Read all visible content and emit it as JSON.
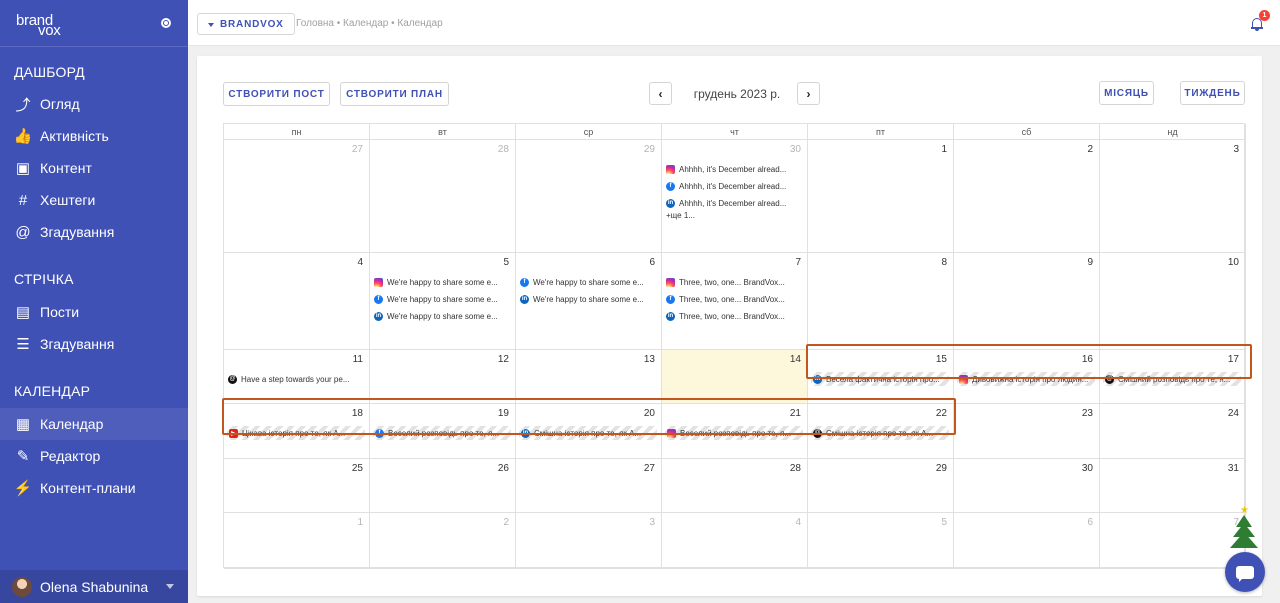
{
  "sidebar": {
    "logo": {
      "top": "brand",
      "bottom": "vox"
    },
    "sections": [
      {
        "title": "ДАШБОРД",
        "items": [
          {
            "label": "Огляд",
            "icon": "chart-icon"
          },
          {
            "label": "Активність",
            "icon": "thumb-up-icon"
          },
          {
            "label": "Контент",
            "icon": "content-icon"
          },
          {
            "label": "Хештеги",
            "icon": "hashtag-icon"
          },
          {
            "label": "Згадування",
            "icon": "at-icon"
          }
        ]
      },
      {
        "title": "СТРІЧКА",
        "items": [
          {
            "label": "Пости",
            "icon": "document-icon"
          },
          {
            "label": "Згадування",
            "icon": "list-icon"
          }
        ]
      },
      {
        "title": "КАЛЕНДАР",
        "items": [
          {
            "label": "Календар",
            "icon": "calendar-icon"
          },
          {
            "label": "Редактор",
            "icon": "editor-icon"
          },
          {
            "label": "Контент-плани",
            "icon": "bolt-icon"
          }
        ]
      }
    ],
    "user": {
      "name": "Olena Shabunina"
    }
  },
  "topbar": {
    "brand_label": "BRANDVOX",
    "breadcrumb": "Головна • Календар • Календар",
    "notifications": "1"
  },
  "toolbar": {
    "create_post": "СТВОРИТИ ПОСТ",
    "create_plan": "СТВОРИТИ ПЛАН",
    "prev": "‹",
    "next": "›",
    "month": "грудень 2023 р.",
    "view_month": "МІСЯЦЬ",
    "view_week": "ТИЖДЕНЬ"
  },
  "calendar": {
    "weekdays": [
      "пн",
      "вт",
      "ср",
      "чт",
      "пт",
      "сб",
      "нд"
    ],
    "weeks": [
      [
        {
          "d": "27",
          "muted": true
        },
        {
          "d": "28",
          "muted": true
        },
        {
          "d": "29",
          "muted": true
        },
        {
          "d": "30",
          "muted": true
        },
        {
          "d": "1"
        },
        {
          "d": "2"
        },
        {
          "d": "3"
        }
      ],
      [
        {
          "d": "4"
        },
        {
          "d": "5"
        },
        {
          "d": "6"
        },
        {
          "d": "7"
        },
        {
          "d": "8"
        },
        {
          "d": "9"
        },
        {
          "d": "10"
        }
      ],
      [
        {
          "d": "11"
        },
        {
          "d": "12"
        },
        {
          "d": "13"
        },
        {
          "d": "14",
          "today": true
        },
        {
          "d": "15"
        },
        {
          "d": "16"
        },
        {
          "d": "17"
        }
      ],
      [
        {
          "d": "18"
        },
        {
          "d": "19"
        },
        {
          "d": "20"
        },
        {
          "d": "21"
        },
        {
          "d": "22"
        },
        {
          "d": "23"
        },
        {
          "d": "24"
        }
      ],
      [
        {
          "d": "25"
        },
        {
          "d": "26"
        },
        {
          "d": "27"
        },
        {
          "d": "28"
        },
        {
          "d": "29"
        },
        {
          "d": "30"
        },
        {
          "d": "31"
        }
      ],
      [
        {
          "d": "1",
          "muted": true
        },
        {
          "d": "2",
          "muted": true
        },
        {
          "d": "3",
          "muted": true
        },
        {
          "d": "4",
          "muted": true
        },
        {
          "d": "5",
          "muted": true
        },
        {
          "d": "6",
          "muted": true
        },
        {
          "d": "7",
          "muted": true
        }
      ]
    ],
    "events": [
      {
        "week": 0,
        "day": 3,
        "row": 0,
        "net": "instagram",
        "text": "Ahhhh, it's December alread..."
      },
      {
        "week": 0,
        "day": 3,
        "row": 1,
        "net": "facebook",
        "text": "Ahhhh, it's December alread..."
      },
      {
        "week": 0,
        "day": 3,
        "row": 2,
        "net": "linkedin",
        "text": "Ahhhh, it's December alread..."
      },
      {
        "week": 1,
        "day": 1,
        "row": 0,
        "net": "instagram",
        "text": "We're happy to share some e..."
      },
      {
        "week": 1,
        "day": 1,
        "row": 1,
        "net": "facebook",
        "text": "We're happy to share some e..."
      },
      {
        "week": 1,
        "day": 1,
        "row": 2,
        "net": "linkedin",
        "text": "We're happy to share some e..."
      },
      {
        "week": 1,
        "day": 2,
        "row": 0,
        "net": "facebook",
        "text": "We're happy to share some e..."
      },
      {
        "week": 1,
        "day": 2,
        "row": 1,
        "net": "linkedin",
        "text": "We're happy to share some e..."
      },
      {
        "week": 1,
        "day": 3,
        "row": 0,
        "net": "instagram",
        "text": "Three, two, one... BrandVox..."
      },
      {
        "week": 1,
        "day": 3,
        "row": 1,
        "net": "facebook",
        "text": "Three, two, one... BrandVox..."
      },
      {
        "week": 1,
        "day": 3,
        "row": 2,
        "net": "linkedin",
        "text": "Three, two, one... BrandVox..."
      },
      {
        "week": 2,
        "day": 0,
        "row": 0,
        "net": "threads",
        "text": "Have a step towards your pe..."
      },
      {
        "week": 2,
        "day": 4,
        "row": 0,
        "net": "linkedin",
        "text": "Весела фактична історія про...",
        "striped": true
      },
      {
        "week": 2,
        "day": 5,
        "row": 0,
        "net": "instagram",
        "text": "Дивовижна історія про людин...",
        "striped": true
      },
      {
        "week": 2,
        "day": 6,
        "row": 0,
        "net": "threads",
        "text": "Смішний розповідь про те, я...",
        "striped": true
      },
      {
        "week": 3,
        "day": 0,
        "row": 0,
        "net": "youtube",
        "text": "Цікава історія про те, як А...",
        "striped": true
      },
      {
        "week": 3,
        "day": 1,
        "row": 0,
        "net": "facebook",
        "text": "Веселий розповідь про те, я...",
        "striped": true
      },
      {
        "week": 3,
        "day": 2,
        "row": 0,
        "net": "linkedin",
        "text": "Смішна історія про те, як А...",
        "striped": true
      },
      {
        "week": 3,
        "day": 3,
        "row": 0,
        "net": "instagram",
        "text": "Веселий розповідь про те, я...",
        "striped": true
      },
      {
        "week": 3,
        "day": 4,
        "row": 0,
        "net": "threads",
        "text": "Смішна історія про те, як А...",
        "striped": true
      }
    ],
    "more": [
      {
        "week": 0,
        "day": 3,
        "text": "+ще 1..."
      }
    ]
  },
  "colors": {
    "accent": "#3f51b5",
    "highlight": "#c1571c",
    "today": "#fdf8dc"
  }
}
